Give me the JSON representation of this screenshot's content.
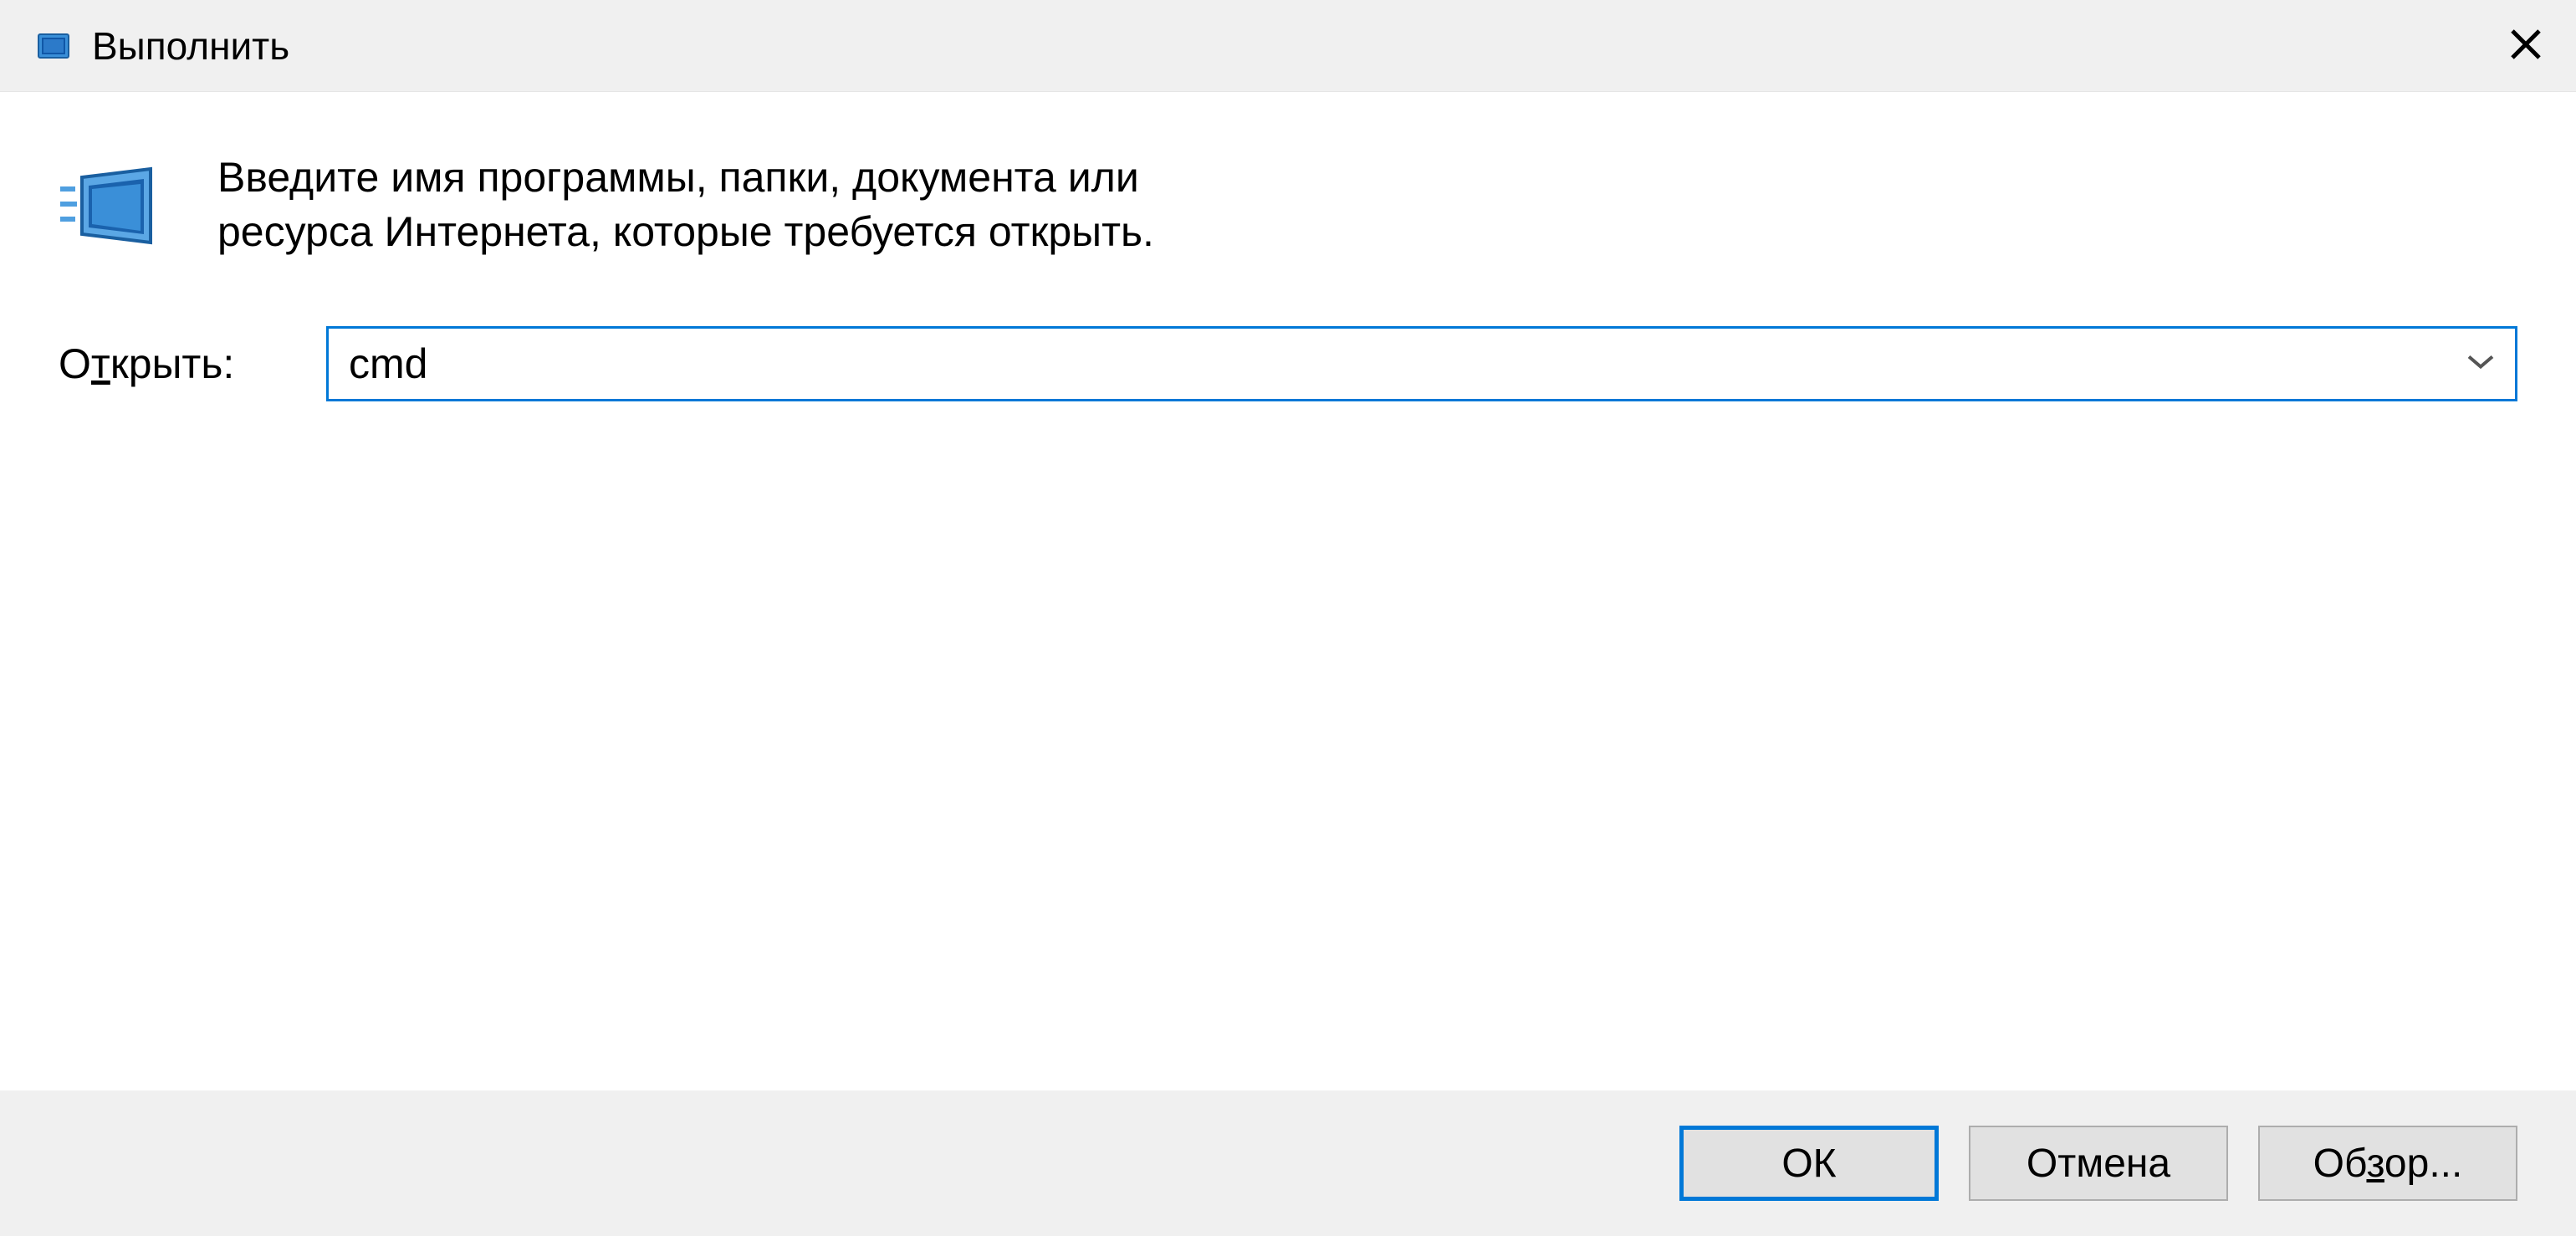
{
  "titlebar": {
    "title": "Выполнить"
  },
  "body": {
    "instruction": "Введите имя программы, папки, документа или ресурса Интернета, которые требуется открыть.",
    "open_label_pre": "О",
    "open_label_accel": "т",
    "open_label_post": "крыть:",
    "input_value": "cmd"
  },
  "buttons": {
    "ok": "ОК",
    "cancel": "Отмена",
    "browse_pre": "Об",
    "browse_accel": "з",
    "browse_post": "ор..."
  }
}
